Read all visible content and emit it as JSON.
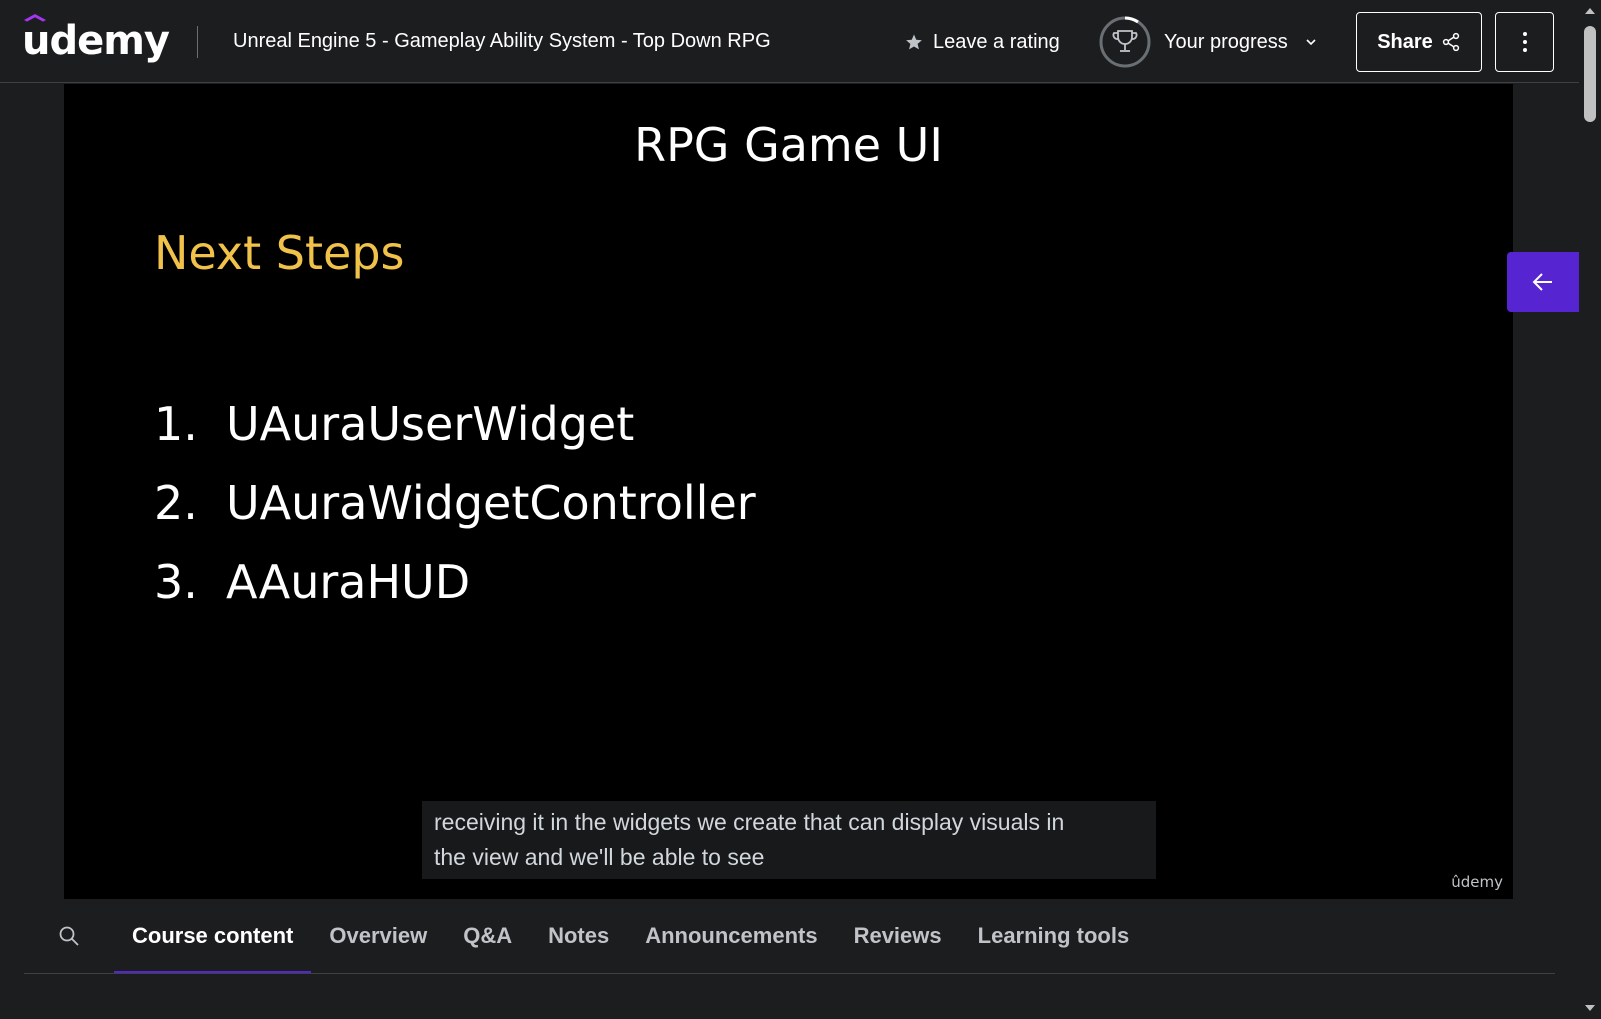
{
  "header": {
    "logo_text": "udemy",
    "course_title": "Unreal Engine 5 - Gameplay Ability System - Top Down RPG",
    "rating_label": "Leave a rating",
    "progress_label": "Your progress",
    "share_label": "Share"
  },
  "slide": {
    "title": "RPG Game UI",
    "subtitle": "Next Steps",
    "items": [
      {
        "num": "1.",
        "text": "UAuraUserWidget"
      },
      {
        "num": "2.",
        "text": "UAuraWidgetController"
      },
      {
        "num": "3.",
        "text": "AAuraHUD"
      }
    ],
    "watermark": "ûdemy"
  },
  "caption": {
    "line1": "receiving it in the widgets we create that can display visuals in",
    "line2": "the view and we'll be able to see"
  },
  "tabs": [
    {
      "label": "Course content",
      "active": true
    },
    {
      "label": "Overview"
    },
    {
      "label": "Q&A"
    },
    {
      "label": "Notes"
    },
    {
      "label": "Announcements"
    },
    {
      "label": "Reviews"
    },
    {
      "label": "Learning tools"
    }
  ],
  "icons": {
    "logo_hat": "graduation-cap-icon",
    "rating": "star-icon",
    "progress": "trophy-icon",
    "progress_chevron": "chevron-down-icon",
    "share": "share-icon",
    "more": "more-vertical-icon",
    "sidebar_toggle": "arrow-left-icon",
    "tab_search": "search-icon"
  },
  "colors": {
    "background": "#1c1d1f",
    "accent": "#5624d0",
    "subtitle": "#f0c24a",
    "border": "#3e4143"
  }
}
